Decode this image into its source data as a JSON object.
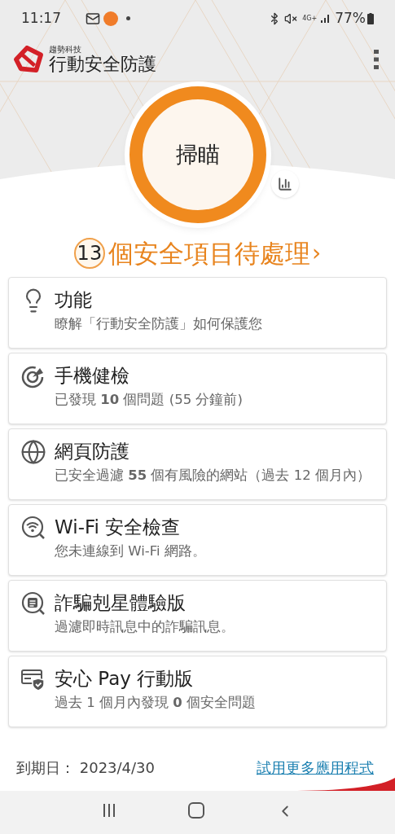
{
  "status_bar": {
    "time": "11:17",
    "network": "4G+",
    "battery": "77%"
  },
  "header": {
    "brand_small": "趨勢科技",
    "brand": "行動安全防護"
  },
  "scan": {
    "label": "掃瞄"
  },
  "pending": {
    "count": "13",
    "text": "個安全項目待處理",
    "arrow": "›"
  },
  "items": [
    {
      "kind": "bulb",
      "title": "功能",
      "description": "瞭解「行動安全防護」如何保護您"
    },
    {
      "kind": "checkup",
      "title": "手機健檢",
      "description": "已發現 **10** 個問題 (55 分鐘前)"
    },
    {
      "kind": "globe",
      "title": "網頁防護",
      "description": "已安全過濾 **55** 個有風險的網站（過去 12 個月內）"
    },
    {
      "kind": "wifi",
      "title": "Wi-Fi 安全檢查",
      "description": "您未連線到 Wi-Fi 網路。"
    },
    {
      "kind": "message",
      "title": "詐騙剋星體驗版",
      "description": "過濾即時訊息中的詐騙訊息。"
    },
    {
      "kind": "pay",
      "title": "安心 Pay 行動版",
      "description": "過去 1 個月內發現 **0** 個安全問題"
    }
  ],
  "footer": {
    "expiry": "到期日： 2023/4/30",
    "link": "試用更多應用程式"
  }
}
